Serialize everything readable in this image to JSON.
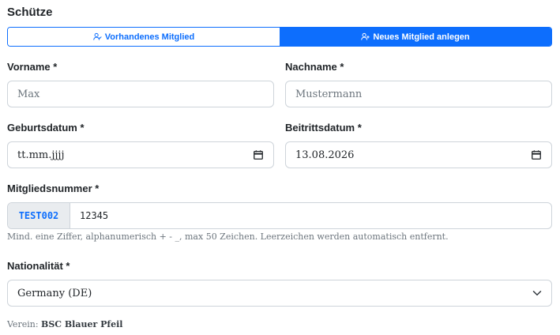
{
  "section": {
    "title": "Schütze"
  },
  "mode_toggle": {
    "existing_label": "Vorhandenes Mitglied",
    "new_label": "Neues Mitglied anlegen",
    "selected": "new"
  },
  "form": {
    "vorname": {
      "label": "Vorname *",
      "value": "",
      "placeholder": "Max"
    },
    "nachname": {
      "label": "Nachname *",
      "value": "",
      "placeholder": "Mustermann"
    },
    "geburtsdatum": {
      "label": "Geburtsdatum *",
      "value": "",
      "placeholder": "tt.mm.jjjj"
    },
    "beitrittsdatum": {
      "label": "Beitrittsdatum *",
      "value": "13.08.2026"
    },
    "mitgliedsnummer": {
      "label": "Mitgliedsnummer *",
      "prefix": "TEST002",
      "value": "12345",
      "hint": "Mind. eine Ziffer, alphanumerisch + - _, max 50 Zeichen. Leerzeichen werden automatisch entfernt."
    },
    "nationalitaet": {
      "label": "Nationalität *",
      "value": "Germany (DE)"
    }
  },
  "verein": {
    "label": "Verein:",
    "name": "BSC Blauer Pfeil"
  },
  "colors": {
    "primary": "#0d6efd",
    "border": "#ced4da",
    "muted": "#6c757d"
  },
  "icons": {
    "existing": "person-check-icon",
    "new": "person-plus-icon",
    "calendar": "calendar-icon",
    "dropdown": "chevron-down-icon"
  }
}
